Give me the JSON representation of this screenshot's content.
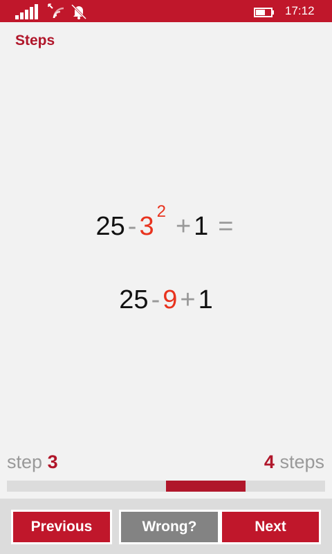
{
  "status_bar": {
    "time": "17:12",
    "icons": [
      "signal-icon",
      "wifi-off-icon",
      "bell-off-icon",
      "battery-icon"
    ],
    "color": "#c0172b"
  },
  "page": {
    "title": "Steps"
  },
  "expressions": {
    "line1": {
      "a": "25",
      "op1": "-",
      "base": "3",
      "exponent": "2",
      "op2": "+",
      "c": "1",
      "eq": "="
    },
    "line2": {
      "a": "25",
      "op1": "-",
      "b": "9",
      "op2": "+",
      "c": "1"
    }
  },
  "progress": {
    "step_word": "step",
    "current_step": "3",
    "total_steps": "4",
    "steps_word": "steps",
    "current": 3,
    "total": 4
  },
  "buttons": {
    "previous": "Previous",
    "wrong": "Wrong?",
    "next": "Next"
  },
  "colors": {
    "accent": "#c0172b",
    "highlight": "#e8331e",
    "operator": "#999999",
    "secondary_button": "#838383"
  }
}
